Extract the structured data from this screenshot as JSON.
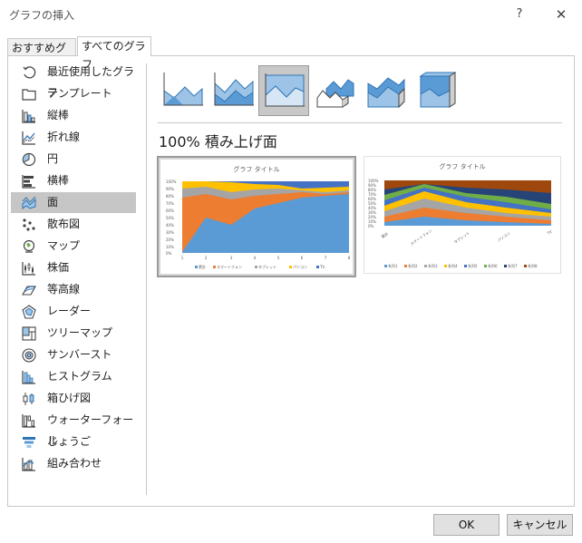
{
  "window": {
    "title": "グラフの挿入",
    "help_label": "?",
    "close_label": "✕"
  },
  "tabs": {
    "recommended": "おすすめグラフ",
    "all": "すべてのグラフ"
  },
  "sidebar": {
    "items": [
      {
        "label": "最近使用したグラフ",
        "icon": "recent-icon"
      },
      {
        "label": "テンプレート",
        "icon": "template-icon"
      },
      {
        "label": "縦棒",
        "icon": "column-chart-icon"
      },
      {
        "label": "折れ線",
        "icon": "line-chart-icon"
      },
      {
        "label": "円",
        "icon": "pie-chart-icon"
      },
      {
        "label": "横棒",
        "icon": "bar-chart-icon"
      },
      {
        "label": "面",
        "icon": "area-chart-icon",
        "selected": true
      },
      {
        "label": "散布図",
        "icon": "scatter-chart-icon"
      },
      {
        "label": "マップ",
        "icon": "map-chart-icon"
      },
      {
        "label": "株価",
        "icon": "stock-chart-icon"
      },
      {
        "label": "等高線",
        "icon": "surface-chart-icon"
      },
      {
        "label": "レーダー",
        "icon": "radar-chart-icon"
      },
      {
        "label": "ツリーマップ",
        "icon": "treemap-chart-icon"
      },
      {
        "label": "サンバースト",
        "icon": "sunburst-chart-icon"
      },
      {
        "label": "ヒストグラム",
        "icon": "histogram-chart-icon"
      },
      {
        "label": "箱ひげ図",
        "icon": "box-whisker-chart-icon"
      },
      {
        "label": "ウォーターフォール",
        "icon": "waterfall-chart-icon"
      },
      {
        "label": "じょうご",
        "icon": "funnel-chart-icon"
      },
      {
        "label": "組み合わせ",
        "icon": "combo-chart-icon"
      }
    ]
  },
  "subtypes": [
    {
      "name": "area",
      "selected": false
    },
    {
      "name": "stacked-area",
      "selected": false
    },
    {
      "name": "100-stacked-area",
      "selected": true
    },
    {
      "name": "3d-area",
      "selected": false
    },
    {
      "name": "3d-stacked-area",
      "selected": false
    },
    {
      "name": "3d-100-stacked-area",
      "selected": false
    }
  ],
  "heading": "100% 積み上げ面",
  "previews": {
    "left": {
      "title": "グラフ タイトル",
      "yticks": [
        "100%",
        "90%",
        "80%",
        "70%",
        "60%",
        "50%",
        "40%",
        "30%",
        "20%",
        "10%",
        "0%"
      ],
      "xticks": [
        "1",
        "2",
        "3",
        "4",
        "5",
        "6",
        "7",
        "8"
      ],
      "legend": [
        "累計",
        "スマートフォン",
        "タブレット",
        "パソコン",
        "TV"
      ],
      "colors": [
        "#5b9bd5",
        "#ed7d31",
        "#a5a5a5",
        "#ffc000",
        "#4472c4"
      ]
    },
    "right": {
      "title": "グラフ タイトル",
      "yticks": [
        "100%",
        "90%",
        "80%",
        "70%",
        "60%",
        "50%",
        "40%",
        "30%",
        "20%",
        "10%",
        "0%"
      ],
      "xticks": [
        "累計",
        "スマートフォン",
        "タブレット",
        "パソコン",
        "TV"
      ],
      "legend": [
        "系列1",
        "系列2",
        "系列3",
        "系列4",
        "系列5",
        "系列6",
        "系列7",
        "系列8"
      ],
      "colors": [
        "#5b9bd5",
        "#ed7d31",
        "#a5a5a5",
        "#ffc000",
        "#4472c4",
        "#70ad47",
        "#264478",
        "#9e480e"
      ]
    }
  },
  "buttons": {
    "ok": "OK",
    "cancel": "キャンセル"
  }
}
